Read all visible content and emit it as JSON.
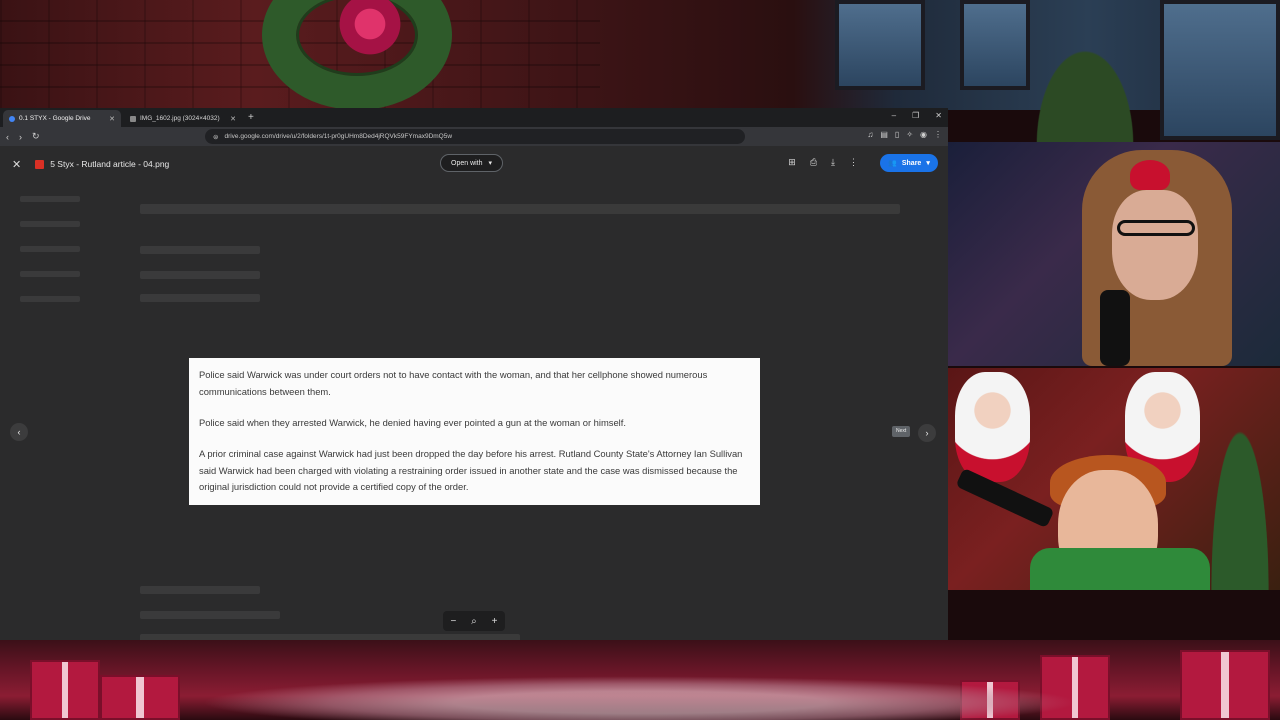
{
  "browser": {
    "tabs": [
      {
        "title": "0.1 STYX - Google Drive",
        "active": true,
        "icon": "google-drive-icon"
      },
      {
        "title": "IMG_1602.jpg (3024×4032)",
        "active": false,
        "icon": "image-icon"
      }
    ],
    "new_tab_label": "+",
    "url": "drive.google.com/drive/u/2/folders/1t-pr0gUHm8Ded4jRQVk59FYmax9DmQ5w"
  },
  "viewer": {
    "file_name": "5 Styx - Rutland article - 04.png",
    "open_with_label": "Open with",
    "share_label": "Share",
    "next_tooltip": "Next"
  },
  "document": {
    "paragraphs": [
      "Police said Warwick was under court orders not to have contact with the woman, and that her cellphone showed numerous communications between them.",
      "Police said when they arrested Warwick, he denied having ever pointed a gun at the woman or himself.",
      "A prior criminal case against Warwick had just been dropped the day before his arrest. Rutland County State's Attorney Ian Sullivan said Warwick had been charged with violating a restraining order issued in another state and the case was dismissed because the original jurisdiction could not provide a certified copy of the order."
    ]
  },
  "zoom": {
    "minus": "−",
    "plus": "+"
  },
  "colors": {
    "share_blue": "#1a73e8",
    "viewer_bg": "#2b2b2c",
    "file_icon_red": "#d93025"
  }
}
